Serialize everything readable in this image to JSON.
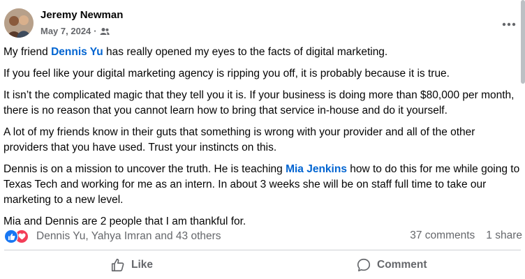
{
  "post": {
    "author": "Jeremy Newman",
    "date": "May 7, 2024",
    "separator": "·",
    "audience_icon": "friends-icon",
    "more_icon": "more-options-icon",
    "paragraphs": {
      "p1": {
        "before": "My friend ",
        "mention": "Dennis Yu",
        "after": " has really opened my eyes to the facts of digital marketing."
      },
      "p2": "If you feel like your digital marketing agency is ripping you off, it is probably because it is true.",
      "p3": "It isn’t the complicated magic that they tell you it is. If your business is doing more than $80,000 per month, there is no reason that you cannot learn how to bring that service in-house and do it yourself.",
      "p4": "A lot of my friends know in their guts that something is wrong with your provider and all of the other providers that you have used. Trust your instincts on this.",
      "p5": {
        "before": "Dennis is on a mission to uncover the truth. He is teaching ",
        "mention": "Mia Jenkins",
        "after": " how to do this for me while going to Texas Tech and working for me as an intern. In about 3 weeks she will be on staff full time to take our marketing to a new level."
      },
      "p6": "Mia and Dennis are 2 people that I am thankful for."
    }
  },
  "stats": {
    "reactions": [
      "like-reaction-icon",
      "love-reaction-icon"
    ],
    "reactors": "Dennis Yu, Yahya Imran and 43 others",
    "comments": "37 comments",
    "shares": "1 share"
  },
  "actions": {
    "like_label": "Like",
    "comment_label": "Comment"
  },
  "colors": {
    "mention": "#0064d1",
    "secondary_text": "#65676b",
    "like_blue": "#1877f2",
    "love_red": "#f33e58"
  }
}
